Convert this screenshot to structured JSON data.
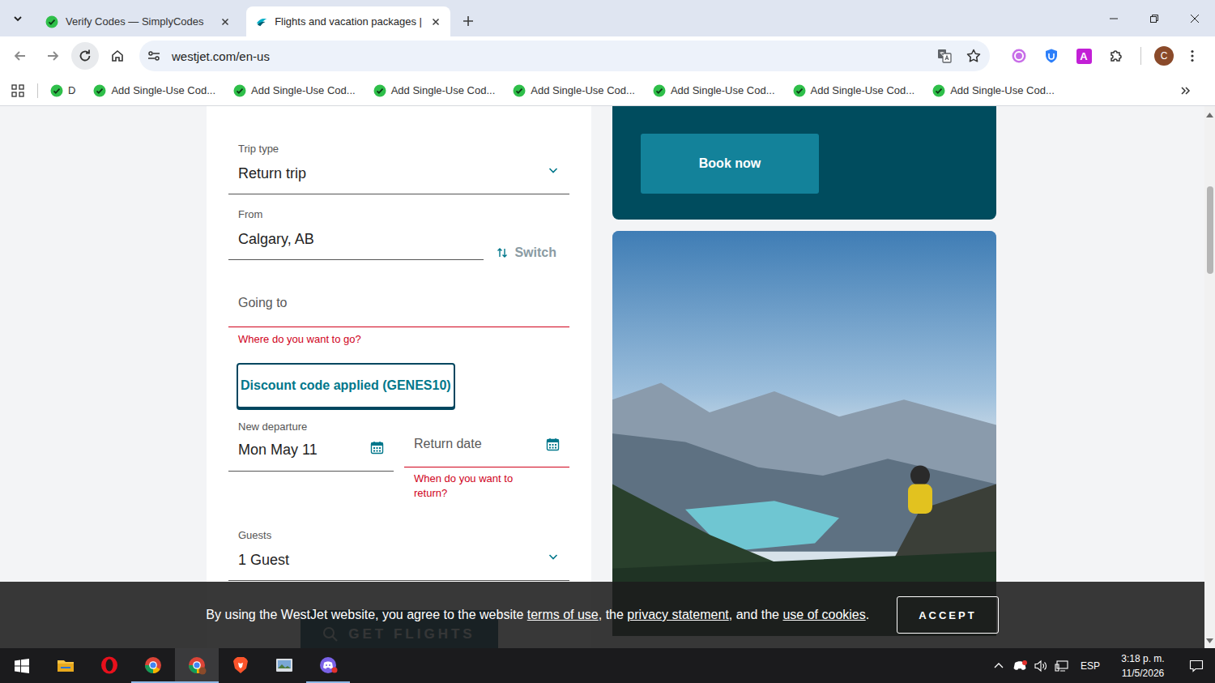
{
  "browser": {
    "tabs": [
      {
        "label": "Verify Codes — SimplyCodes",
        "selected": false
      },
      {
        "label": "Flights and vacation packages |",
        "selected": true
      }
    ],
    "address": "westjet.com/en-us",
    "extension_badge": "A",
    "profile": "C",
    "bookmarks": [
      "D",
      "Add Single-Use Cod...",
      "Add Single-Use Cod...",
      "Add Single-Use Cod...",
      "Add Single-Use Cod...",
      "Add Single-Use Cod...",
      "Add Single-Use Cod...",
      "Add Single-Use Cod..."
    ]
  },
  "form": {
    "trip_type": {
      "label": "Trip type",
      "value": "Return trip"
    },
    "from": {
      "label": "From",
      "value": "Calgary, AB"
    },
    "switch": "Switch",
    "going_to": {
      "placeholder": "Going to",
      "error": "Where do you want to go?",
      "invalid": true
    },
    "discount": "Discount code applied (GENES10)",
    "departure": {
      "label": "New departure",
      "value": "Mon May 11"
    },
    "return": {
      "placeholder": "Return date",
      "error": "When do you want to return?",
      "invalid": true
    },
    "guests": {
      "label": "Guests",
      "value": "1 Guest"
    },
    "submit": "GET FLIGHTS"
  },
  "promo": {
    "button": "Book now"
  },
  "cookie_banner": {
    "segments": [
      {
        "text": "By using the WestJet website, you agree to the website ",
        "link": false
      },
      {
        "text": "terms of use",
        "link": true
      },
      {
        "text": ", the ",
        "link": false
      },
      {
        "text": "privacy statement",
        "link": true
      },
      {
        "text": ", and the ",
        "link": false
      },
      {
        "text": "use of cookies",
        "link": true
      },
      {
        "text": ".",
        "link": false
      }
    ],
    "button": "ACCEPT"
  },
  "taskbar": {
    "apps": [
      {
        "kind": "explorer",
        "running": false,
        "selected": false
      },
      {
        "kind": "opera",
        "running": false,
        "selected": false
      },
      {
        "kind": "chrome",
        "running": true,
        "selected": false
      },
      {
        "kind": "chrome-profile",
        "running": true,
        "selected": true
      },
      {
        "kind": "brave",
        "running": false,
        "selected": false
      },
      {
        "kind": "app",
        "running": false,
        "selected": false
      },
      {
        "kind": "discord",
        "running": true,
        "selected": false
      }
    ],
    "language": "ESP",
    "time": "3:18 p. m.",
    "date": "11/5/2026"
  }
}
